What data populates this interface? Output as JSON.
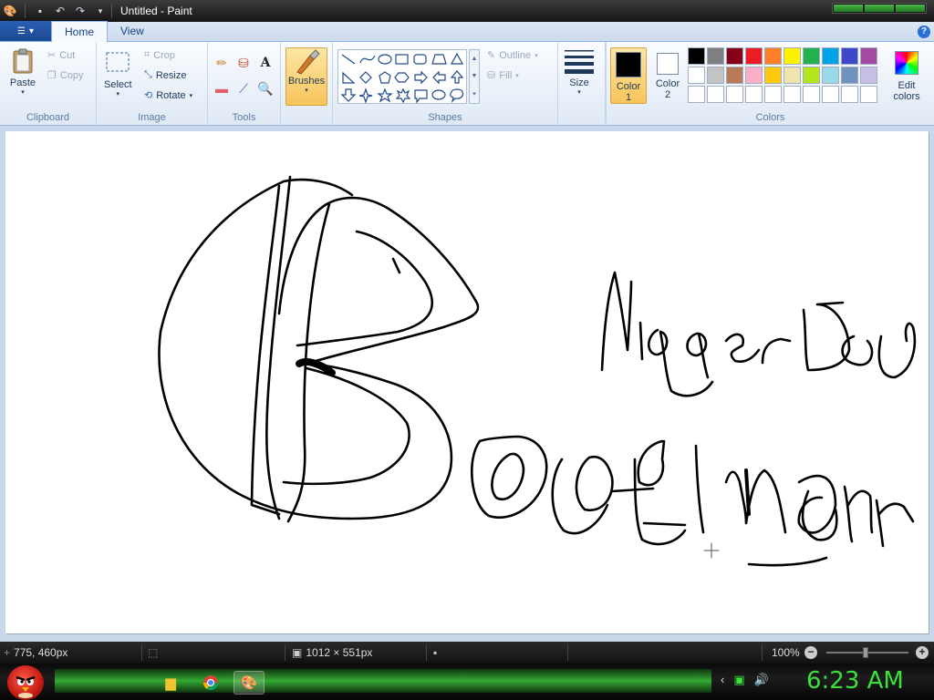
{
  "window": {
    "title": "Untitled - Paint",
    "quick_access": [
      "paint-logo",
      "save",
      "undo",
      "redo",
      "customize"
    ]
  },
  "tabs": {
    "app_menu": "▾",
    "items": [
      "Home",
      "View"
    ],
    "active": "Home"
  },
  "ribbon": {
    "clipboard": {
      "label": "Clipboard",
      "paste": "Paste",
      "cut": "Cut",
      "copy": "Copy"
    },
    "image": {
      "label": "Image",
      "select": "Select",
      "crop": "Crop",
      "resize": "Resize",
      "rotate": "Rotate"
    },
    "tools": {
      "label": "Tools",
      "items": [
        "pencil",
        "fill",
        "text",
        "eraser",
        "color-picker",
        "magnifier"
      ]
    },
    "brushes": {
      "label": "Brushes"
    },
    "shapes": {
      "label": "Shapes",
      "outline": "Outline",
      "fill": "Fill"
    },
    "size": {
      "label": "Size"
    },
    "colors": {
      "label": "Colors",
      "color1_label": "Color",
      "color1_num": "1",
      "color2_label": "Color",
      "color2_num": "2",
      "edit_label": "Edit",
      "edit_label2": "colors",
      "color1": "#000000",
      "color2": "#ffffff",
      "palette_row1": [
        "#000000",
        "#7f7f7f",
        "#880015",
        "#ed1c24",
        "#ff7f27",
        "#fff200",
        "#22b14c",
        "#00a2e8",
        "#3f48cc",
        "#a349a4"
      ],
      "palette_row2": [
        "#ffffff",
        "#c3c3c3",
        "#b97a57",
        "#ffaec9",
        "#ffc90e",
        "#efe4b0",
        "#b5e61d",
        "#99d9ea",
        "#7092be",
        "#c8bfe7"
      ],
      "palette_row3": [
        "#ffffff",
        "#ffffff",
        "#ffffff",
        "#ffffff",
        "#ffffff",
        "#ffffff",
        "#ffffff",
        "#ffffff",
        "#ffffff",
        "#ffffff"
      ]
    }
  },
  "status": {
    "cursor_pos": "775, 460px",
    "canvas_size": "1012 × 551px",
    "zoom": "100%"
  },
  "taskbar": {
    "clock": "6:23 AM"
  }
}
